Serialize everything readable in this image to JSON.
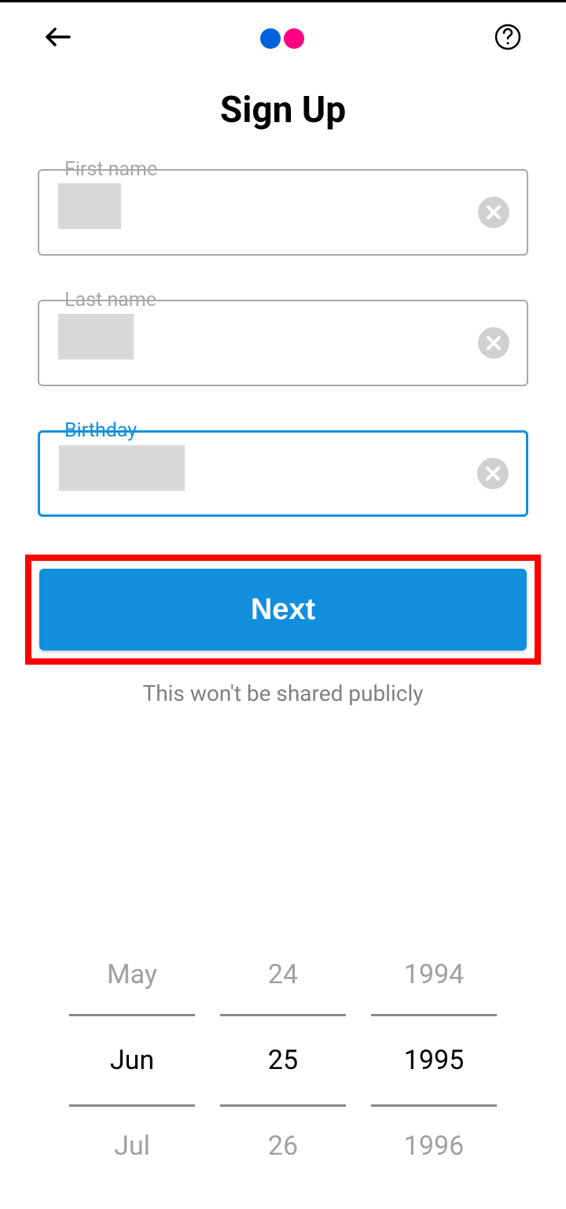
{
  "header": {
    "title": "Sign Up"
  },
  "form": {
    "first_name_label": "First name",
    "last_name_label": "Last name",
    "birthday_label": "Birthday",
    "next_button": "Next",
    "privacy_note": "This won't be shared publicly"
  },
  "date_picker": {
    "month": {
      "prev": "May",
      "selected": "Jun",
      "next": "Jul"
    },
    "day": {
      "prev": "24",
      "selected": "25",
      "next": "26"
    },
    "year": {
      "prev": "1994",
      "selected": "1995",
      "next": "1996"
    }
  },
  "colors": {
    "primary_blue": "#128fdc",
    "logo_blue": "#0063dc",
    "logo_pink": "#ff0084",
    "highlight_red": "#ff0000"
  }
}
